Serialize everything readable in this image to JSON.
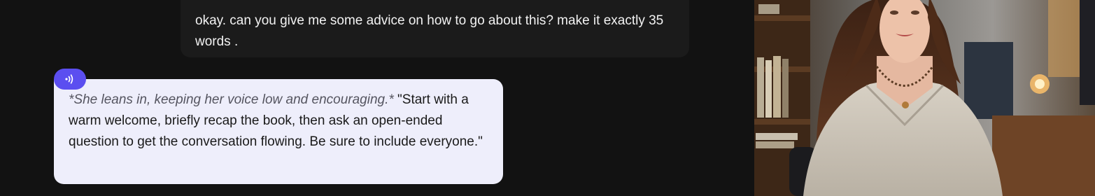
{
  "chat": {
    "user_message": "okay. can you give me some advice on how to go about this? make it exactly 35 words .",
    "ai_message": {
      "action": "*She leans in, keeping her voice low and encouraging.*",
      "speech": " \"Start with a warm welcome, briefly recap the book, then ask an open-ended question to get the conversation flowing. Be sure to include everyone.\""
    },
    "audio_icon": "audio-waves-icon"
  },
  "colors": {
    "background": "#121212",
    "user_bubble": "#1b1b1b",
    "ai_bubble": "#eeeefb",
    "accent": "#5b4ef0"
  },
  "character_image": {
    "icon": "character-portrait"
  }
}
